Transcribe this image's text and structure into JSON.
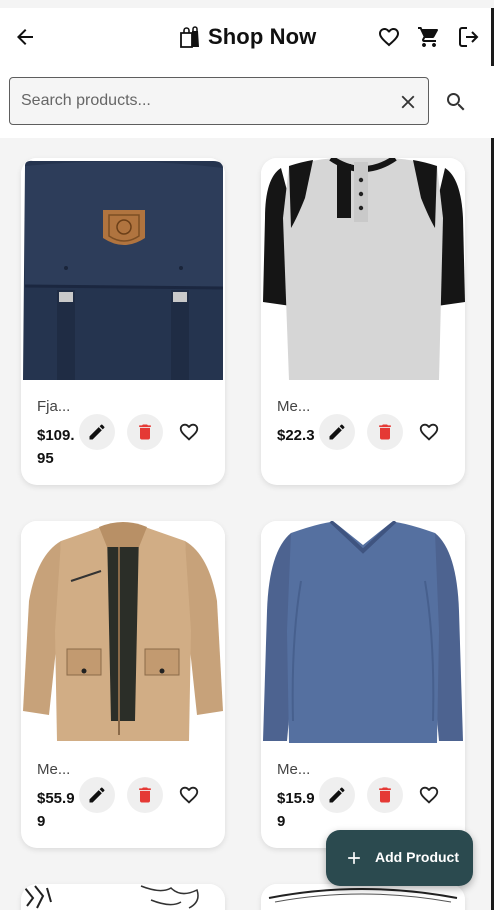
{
  "appbar": {
    "title": "Shop Now",
    "icons": [
      "arrow-back-icon",
      "shopping-bag-icon",
      "heart-outline-icon",
      "cart-icon",
      "logout-icon"
    ]
  },
  "search": {
    "placeholder": "Search products...",
    "value": ""
  },
  "products": [
    {
      "name": "Fja...",
      "price": "$109.95",
      "image": "navy-backpack"
    },
    {
      "name": "Me...",
      "price": "$22.3",
      "image": "raglan-henley-tshirt"
    },
    {
      "name": "Me...",
      "price": "$55.99",
      "image": "khaki-jacket"
    },
    {
      "name": "Me...",
      "price": "$15.99",
      "image": "blue-longsleeve-tshirt"
    }
  ],
  "colors": {
    "accent": "#2b4a4f",
    "delete": "#e53935"
  },
  "fab": {
    "label": "Add Product"
  }
}
